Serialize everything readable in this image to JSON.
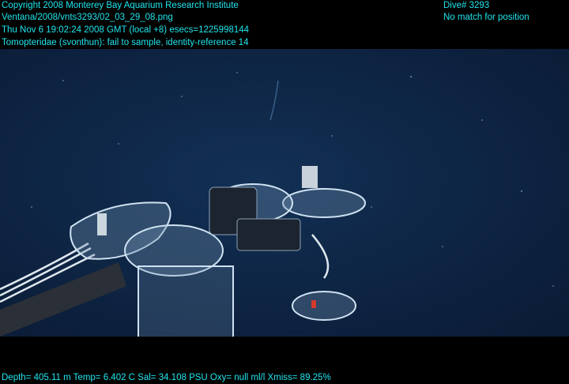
{
  "overlay": {
    "top_left": [
      "Copyright 2008 Monterey Bay Aquarium Research Institute",
      "Ventana/2008/vnts3293/02_03_29_08.png",
      "Thu Nov  6 19:02:24 2008 GMT (local +8)  esecs=1225998144",
      "Tomopteridae (svonthun): fail to sample, identity-reference 14"
    ],
    "top_right": [
      "Dive# 3293",
      "No match for position"
    ],
    "bottom": "Depth= 405.11 m  Temp= 6.402 C  Sal= 34.108 PSU  Oxy= null ml/l  Xmiss= 89.25%",
    "color": "#1fe6ee"
  },
  "scene": {
    "background_color": "#0e2340",
    "subject": "ROV sampling gear with clear acrylic rings and tubing in dark water"
  }
}
